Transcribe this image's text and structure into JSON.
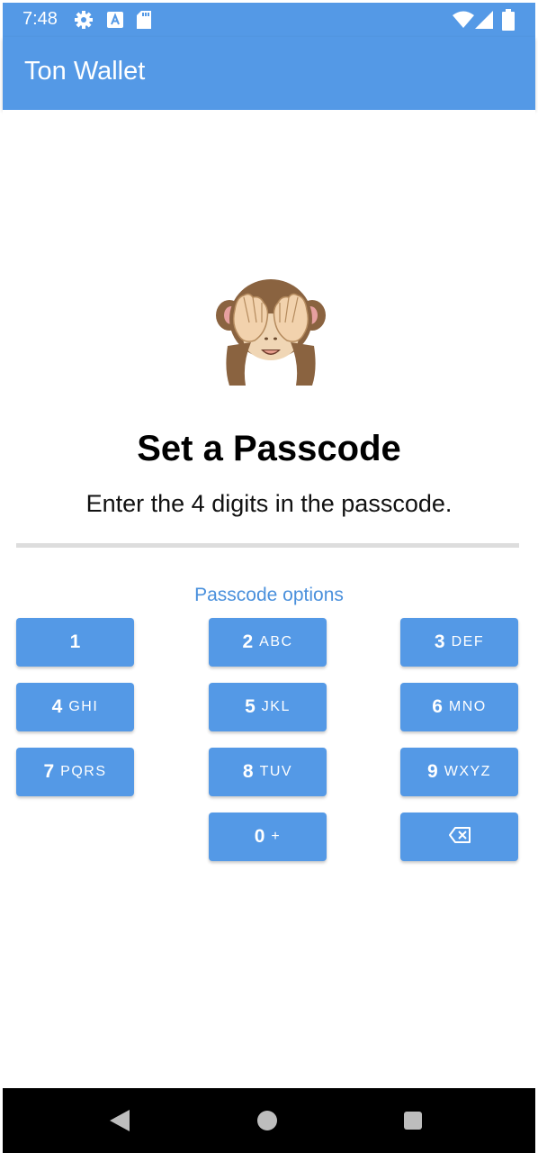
{
  "status_bar": {
    "time": "7:48",
    "left_icons": [
      "gear-icon",
      "a-badge-icon",
      "sd-card-icon"
    ],
    "right_icons": [
      "wifi-icon",
      "signal-icon",
      "battery-icon"
    ]
  },
  "app_bar": {
    "title": "Ton Wallet"
  },
  "hero_icon": "see-no-evil-monkey-icon",
  "main": {
    "title": "Set a Passcode",
    "subtitle": "Enter the 4 digits in the passcode.",
    "options_link": "Passcode options"
  },
  "keypad": {
    "keys": [
      {
        "num": "1",
        "letters": ""
      },
      {
        "num": "2",
        "letters": "ABC"
      },
      {
        "num": "3",
        "letters": "DEF"
      },
      {
        "num": "4",
        "letters": "GHI"
      },
      {
        "num": "5",
        "letters": "JKL"
      },
      {
        "num": "6",
        "letters": "MNO"
      },
      {
        "num": "7",
        "letters": "PQRS"
      },
      {
        "num": "8",
        "letters": "TUV"
      },
      {
        "num": "9",
        "letters": "WXYZ"
      },
      {
        "num": "0",
        "letters": "+"
      }
    ],
    "backspace_icon": "backspace-icon"
  },
  "nav_bar": {
    "icons": [
      "back-icon",
      "home-icon",
      "recents-icon"
    ]
  },
  "colors": {
    "primary": "#5499e6",
    "link": "#4a90dc",
    "divider": "#dddddd"
  }
}
